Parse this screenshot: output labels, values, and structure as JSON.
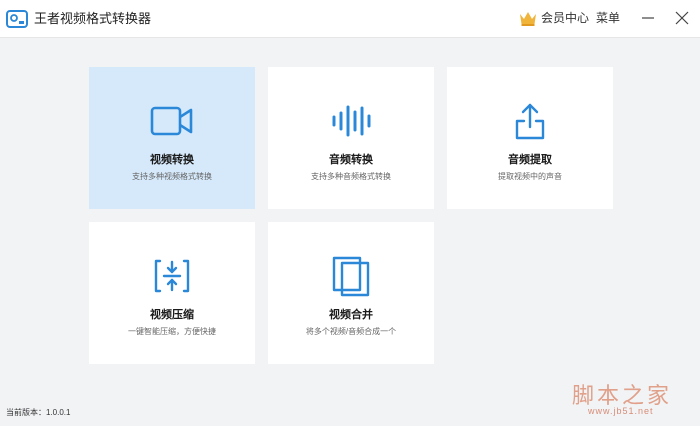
{
  "app": {
    "title": "王者视频格式转换器",
    "logo_icon": "video-camera-logo-icon"
  },
  "header": {
    "vip_label": "会员中心",
    "vip_icon": "crown-icon",
    "menu_label": "菜单",
    "minimize_icon": "minimize-icon",
    "close_icon": "close-icon"
  },
  "cards": [
    {
      "title": "视频转换",
      "desc": "支持多种视频格式转换",
      "icon": "video-camera-icon",
      "active": true
    },
    {
      "title": "音频转换",
      "desc": "支持多种音频格式转换",
      "icon": "audio-wave-icon",
      "active": false
    },
    {
      "title": "音频提取",
      "desc": "提取视频中的声音",
      "icon": "upload-tray-icon",
      "active": false
    },
    {
      "title": "视频压缩",
      "desc": "一键智能压缩，方便快捷",
      "icon": "compress-icon",
      "active": false
    },
    {
      "title": "视频合并",
      "desc": "将多个视频/音频合成一个",
      "icon": "merge-pages-icon",
      "active": false
    }
  ],
  "footer": {
    "version": "当前版本：1.0.0.1"
  },
  "watermark": {
    "text": "脚本之家",
    "url": "www.jb51.net"
  },
  "colors": {
    "accent": "#2b88d8",
    "active_card": "#d5e9fb",
    "vip_crown": "#f0b43a"
  }
}
